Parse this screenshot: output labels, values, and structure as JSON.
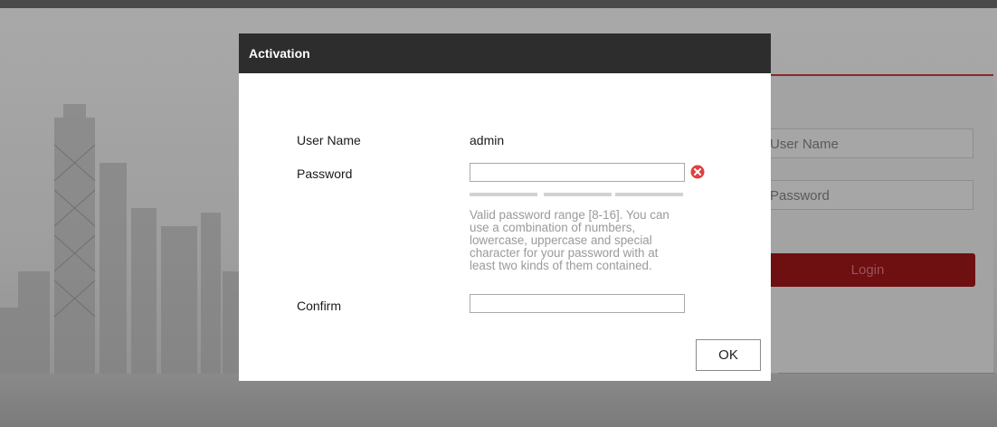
{
  "background": {
    "username_placeholder": "User Name",
    "password_placeholder": "Password",
    "login_label": "Login"
  },
  "dialog": {
    "title": "Activation",
    "username_label": "User Name",
    "username_value": "admin",
    "password_label": "Password",
    "password_value": "",
    "password_status_icon": "error-icon",
    "strength_levels": 3,
    "hint": "Valid password range [8-16]. You can use a combination of numbers, lowercase, uppercase and special character for your password with at least two kinds of them contained.",
    "confirm_label": "Confirm",
    "confirm_value": "",
    "ok_label": "OK"
  },
  "colors": {
    "header": "#2d2d2d",
    "error": "#e0403f",
    "login_button": "#6e0f12"
  }
}
